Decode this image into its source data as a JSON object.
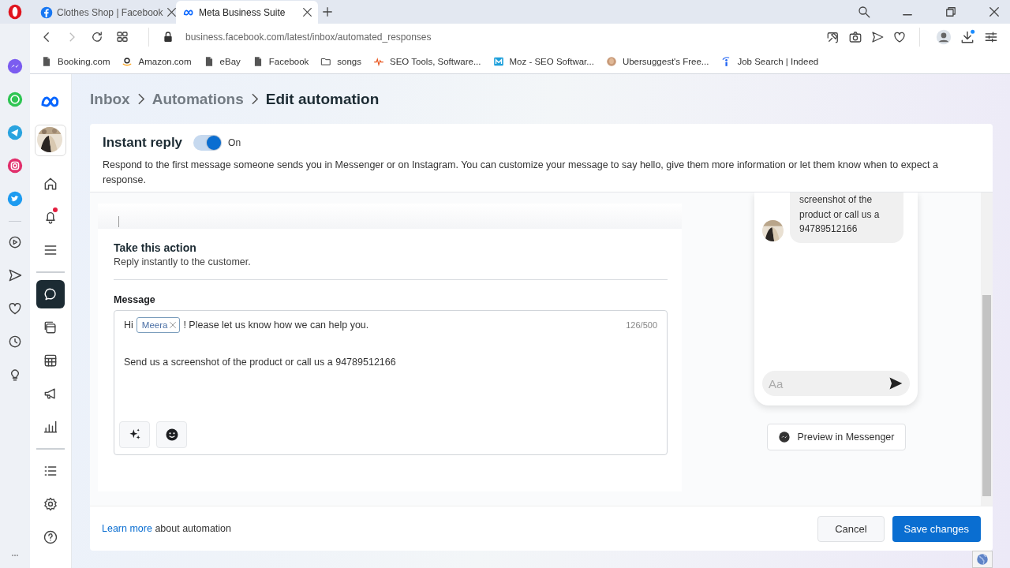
{
  "browser": {
    "tabs": [
      {
        "title": "Clothes Shop | Facebook",
        "selected": false
      },
      {
        "title": "Meta Business Suite",
        "selected": true
      }
    ],
    "url": "business.facebook.com/latest/inbox/automated_responses",
    "bookmarks": [
      "Booking.com",
      "Amazon.com",
      "eBay",
      "Facebook",
      "songs",
      "SEO Tools, Software...",
      "Moz - SEO Softwar...",
      "Ubersuggest's Free...",
      "Job Search | Indeed"
    ]
  },
  "nav_groups": [
    [
      {
        "kind": "home",
        "selected": false
      },
      {
        "kind": "bell",
        "selected": false,
        "badge": true
      },
      {
        "kind": "menu",
        "selected": false
      }
    ],
    [
      {
        "kind": "chat",
        "selected": true
      },
      {
        "kind": "pages",
        "selected": false
      },
      {
        "kind": "table",
        "selected": false
      },
      {
        "kind": "megaphone",
        "selected": false
      },
      {
        "kind": "chart",
        "selected": false
      }
    ],
    [
      {
        "kind": "list",
        "selected": false
      },
      {
        "kind": "gear",
        "selected": false
      },
      {
        "kind": "help",
        "selected": false
      }
    ]
  ],
  "breadcrumb": [
    "Inbox",
    "Automations",
    "Edit automation"
  ],
  "instant_reply": {
    "title": "Instant reply",
    "on": true,
    "state_label": "On",
    "description": "Respond to the first message someone sends you in Messenger or on Instagram. You can customize your message to say hello, give them more information or let them know when to expect a response."
  },
  "action": {
    "title": "Take this action",
    "subtitle": "Reply instantly to the customer.",
    "message_label": "Message",
    "greeting": "Hi",
    "name_tag": "Meera",
    "line_1": "! Please let us know how we can help you.",
    "counter": "126/500",
    "line_2": "Send us a screenshot of the product or call us a 94789512166"
  },
  "preview": {
    "bubble": "screenshot of the product or call us a 94789512166",
    "input_placeholder": "Aa",
    "button": "Preview in Messenger"
  },
  "footer": {
    "link": "Learn more",
    "text": "about automation",
    "cancel": "Cancel",
    "save": "Save changes"
  }
}
